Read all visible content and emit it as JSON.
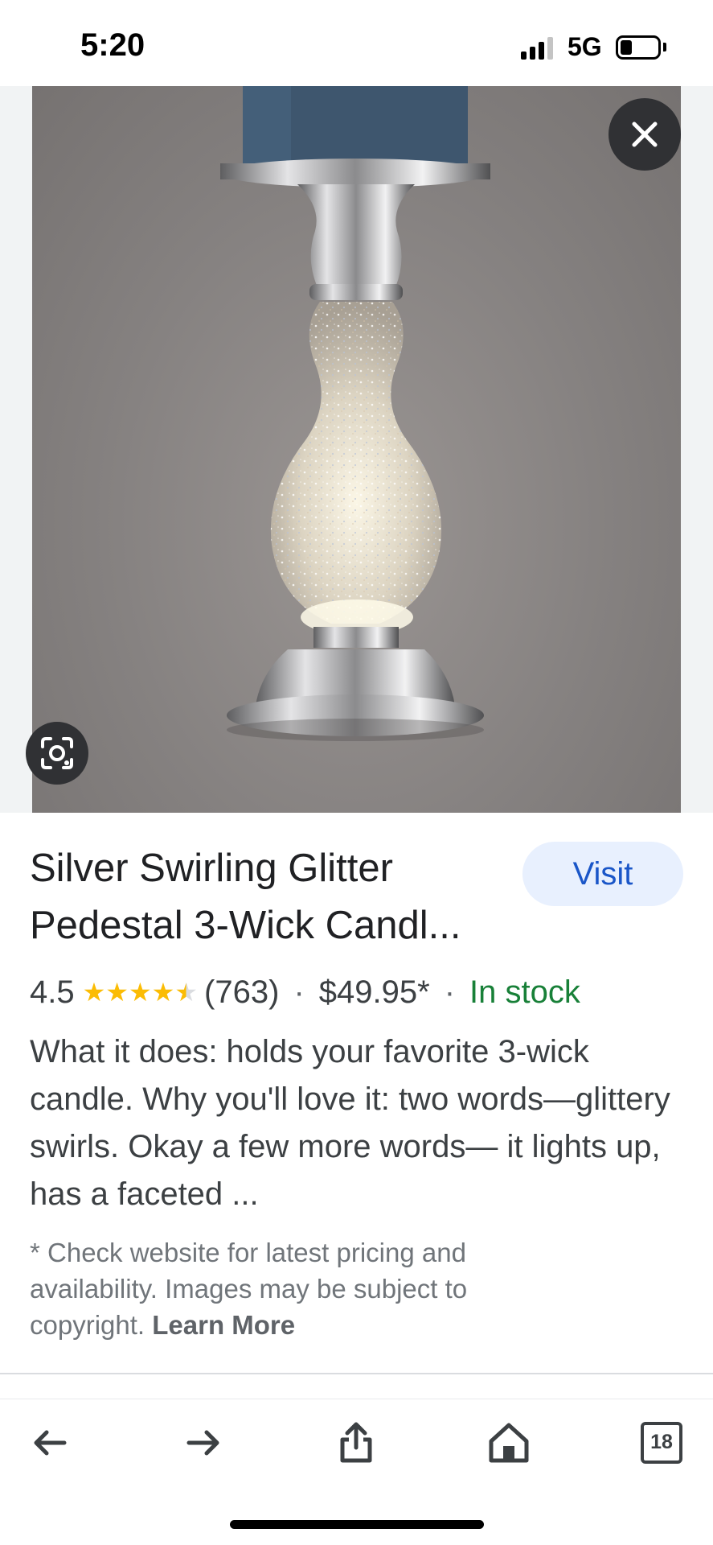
{
  "status_bar": {
    "time": "5:20",
    "network": "5G",
    "signal_bars_active": 3,
    "battery_level_percent": 25
  },
  "image": {
    "subject": "silver glitter pedestal candle holder",
    "background_color": "#857f7d"
  },
  "product": {
    "title": "Silver Swirling Glitter Pedestal 3-Wick Candl...",
    "visit_label": "Visit",
    "rating": "4.5",
    "rating_value": 4.5,
    "reviews": "(763)",
    "separator": "·",
    "price": "$49.95*",
    "stock": "In stock",
    "description": "What it does: holds your favorite 3-wick candle. Why you'll love it: two words—glittery swirls. Okay a few more words— it lights up, has a faceted ...",
    "disclaimer": "* Check website for latest pricing and availability. Images may be subject to copyright.",
    "learn_more": "Learn More"
  },
  "toolbar": {
    "back_icon": "arrow-left-icon",
    "forward_icon": "arrow-right-icon",
    "share_icon": "share-icon",
    "home_icon": "home-icon",
    "tabs_count": "18"
  },
  "colors": {
    "visit_bg": "#e8f0fe",
    "visit_text": "#1a56c8",
    "in_stock": "#188038",
    "star": "#fbbc04"
  }
}
